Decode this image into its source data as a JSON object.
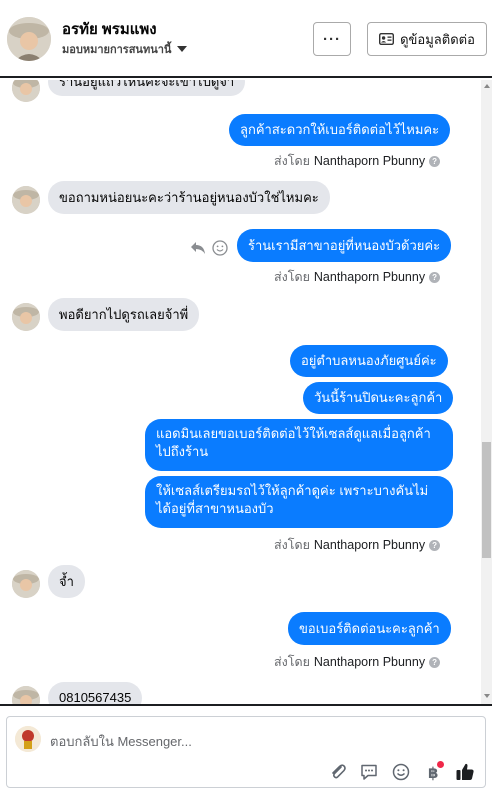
{
  "header": {
    "name": "อรทัย พรมแพง",
    "assign_label": "มอบหมายการสนทนานี้",
    "more_label": "···",
    "contact_label": "ดูข้อมูลติดต่อ"
  },
  "conversation": {
    "partial_top": "ร้านอยู่แถวไหนคะจะเข้าไปดูจ้า",
    "messages": {
      "m1": "ลูกค้าสะดวกให้เบอร์ติดต่อไว้ไหมคะ",
      "m2": "ขอถามหน่อยนะคะว่าร้านอยู่หนองบัวใช่ไหมคะ",
      "m3": "ร้านเรามีสาขาอยู่ที่หนองบัวด้วยค่ะ",
      "m4": "พอดียากไปดูรถเลยจ้าพี่",
      "m5": "อยู่ตำบลหนองภัยศูนย์ค่ะ",
      "m6": "วันนี้ร้านปิดนะคะลูกค้า",
      "m7": "แอดมินเลยขอเบอร์ติดต่อไว้ให้เซลส์ดูแลเมื่อลูกค้าไปถึงร้าน",
      "m8": "ให้เซลส์เตรียมรถไว้ให้ลูกค้าดูค่ะ เพราะบางคันไม่ได้อยู่ที่สาขาหนองบัว",
      "m9": "จ้ำ",
      "m10": "ขอเบอร์ติดต่อนะคะลูกค้า",
      "m11": "0810567435"
    },
    "sent_by_prefix": "ส่งโดย",
    "sent_by_name": "Nanthaporn Pbunny"
  },
  "composer": {
    "placeholder": "ตอบกลับใน Messenger..."
  },
  "colors": {
    "outgoing": "#0a7cff",
    "incoming": "#e4e6eb",
    "notification_dot": "#f02849"
  },
  "icons": [
    "more-icon",
    "contact-card-icon",
    "caret-down-icon",
    "reply-icon",
    "smiley-icon",
    "info-icon",
    "attach-icon",
    "saved-reply-icon",
    "emoji-icon",
    "currency-icon",
    "thumbs-up-icon"
  ]
}
